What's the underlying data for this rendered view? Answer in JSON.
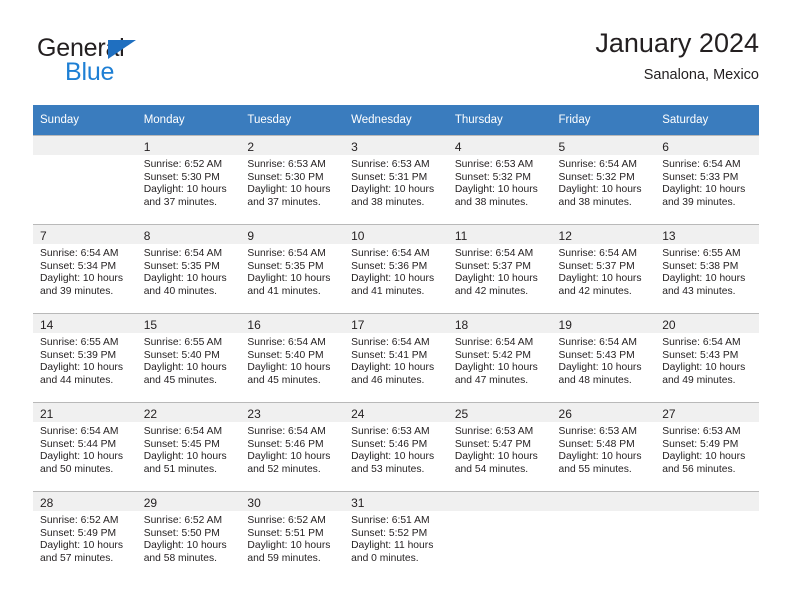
{
  "brand": {
    "name_dark": "General",
    "name_blue": "Blue",
    "triangle_color": "#1f6fc0",
    "blue_color": "#1e7fd4"
  },
  "header": {
    "title": "January 2024",
    "subtitle": "Sanalona, Mexico"
  },
  "theme": {
    "header_row_bg": "#3a7cbe",
    "daynum_band_bg": "#f0f0f0",
    "grid_line": "#b9b9b9",
    "text": "#231f20"
  },
  "weekday_headers": [
    "Sunday",
    "Monday",
    "Tuesday",
    "Wednesday",
    "Thursday",
    "Friday",
    "Saturday"
  ],
  "weeks": [
    [
      {
        "day": "",
        "lines": []
      },
      {
        "day": "1",
        "lines": [
          "Sunrise: 6:52 AM",
          "Sunset: 5:30 PM",
          "Daylight: 10 hours",
          "and 37 minutes."
        ]
      },
      {
        "day": "2",
        "lines": [
          "Sunrise: 6:53 AM",
          "Sunset: 5:30 PM",
          "Daylight: 10 hours",
          "and 37 minutes."
        ]
      },
      {
        "day": "3",
        "lines": [
          "Sunrise: 6:53 AM",
          "Sunset: 5:31 PM",
          "Daylight: 10 hours",
          "and 38 minutes."
        ]
      },
      {
        "day": "4",
        "lines": [
          "Sunrise: 6:53 AM",
          "Sunset: 5:32 PM",
          "Daylight: 10 hours",
          "and 38 minutes."
        ]
      },
      {
        "day": "5",
        "lines": [
          "Sunrise: 6:54 AM",
          "Sunset: 5:32 PM",
          "Daylight: 10 hours",
          "and 38 minutes."
        ]
      },
      {
        "day": "6",
        "lines": [
          "Sunrise: 6:54 AM",
          "Sunset: 5:33 PM",
          "Daylight: 10 hours",
          "and 39 minutes."
        ]
      }
    ],
    [
      {
        "day": "7",
        "lines": [
          "Sunrise: 6:54 AM",
          "Sunset: 5:34 PM",
          "Daylight: 10 hours",
          "and 39 minutes."
        ]
      },
      {
        "day": "8",
        "lines": [
          "Sunrise: 6:54 AM",
          "Sunset: 5:35 PM",
          "Daylight: 10 hours",
          "and 40 minutes."
        ]
      },
      {
        "day": "9",
        "lines": [
          "Sunrise: 6:54 AM",
          "Sunset: 5:35 PM",
          "Daylight: 10 hours",
          "and 41 minutes."
        ]
      },
      {
        "day": "10",
        "lines": [
          "Sunrise: 6:54 AM",
          "Sunset: 5:36 PM",
          "Daylight: 10 hours",
          "and 41 minutes."
        ]
      },
      {
        "day": "11",
        "lines": [
          "Sunrise: 6:54 AM",
          "Sunset: 5:37 PM",
          "Daylight: 10 hours",
          "and 42 minutes."
        ]
      },
      {
        "day": "12",
        "lines": [
          "Sunrise: 6:54 AM",
          "Sunset: 5:37 PM",
          "Daylight: 10 hours",
          "and 42 minutes."
        ]
      },
      {
        "day": "13",
        "lines": [
          "Sunrise: 6:55 AM",
          "Sunset: 5:38 PM",
          "Daylight: 10 hours",
          "and 43 minutes."
        ]
      }
    ],
    [
      {
        "day": "14",
        "lines": [
          "Sunrise: 6:55 AM",
          "Sunset: 5:39 PM",
          "Daylight: 10 hours",
          "and 44 minutes."
        ]
      },
      {
        "day": "15",
        "lines": [
          "Sunrise: 6:55 AM",
          "Sunset: 5:40 PM",
          "Daylight: 10 hours",
          "and 45 minutes."
        ]
      },
      {
        "day": "16",
        "lines": [
          "Sunrise: 6:54 AM",
          "Sunset: 5:40 PM",
          "Daylight: 10 hours",
          "and 45 minutes."
        ]
      },
      {
        "day": "17",
        "lines": [
          "Sunrise: 6:54 AM",
          "Sunset: 5:41 PM",
          "Daylight: 10 hours",
          "and 46 minutes."
        ]
      },
      {
        "day": "18",
        "lines": [
          "Sunrise: 6:54 AM",
          "Sunset: 5:42 PM",
          "Daylight: 10 hours",
          "and 47 minutes."
        ]
      },
      {
        "day": "19",
        "lines": [
          "Sunrise: 6:54 AM",
          "Sunset: 5:43 PM",
          "Daylight: 10 hours",
          "and 48 minutes."
        ]
      },
      {
        "day": "20",
        "lines": [
          "Sunrise: 6:54 AM",
          "Sunset: 5:43 PM",
          "Daylight: 10 hours",
          "and 49 minutes."
        ]
      }
    ],
    [
      {
        "day": "21",
        "lines": [
          "Sunrise: 6:54 AM",
          "Sunset: 5:44 PM",
          "Daylight: 10 hours",
          "and 50 minutes."
        ]
      },
      {
        "day": "22",
        "lines": [
          "Sunrise: 6:54 AM",
          "Sunset: 5:45 PM",
          "Daylight: 10 hours",
          "and 51 minutes."
        ]
      },
      {
        "day": "23",
        "lines": [
          "Sunrise: 6:54 AM",
          "Sunset: 5:46 PM",
          "Daylight: 10 hours",
          "and 52 minutes."
        ]
      },
      {
        "day": "24",
        "lines": [
          "Sunrise: 6:53 AM",
          "Sunset: 5:46 PM",
          "Daylight: 10 hours",
          "and 53 minutes."
        ]
      },
      {
        "day": "25",
        "lines": [
          "Sunrise: 6:53 AM",
          "Sunset: 5:47 PM",
          "Daylight: 10 hours",
          "and 54 minutes."
        ]
      },
      {
        "day": "26",
        "lines": [
          "Sunrise: 6:53 AM",
          "Sunset: 5:48 PM",
          "Daylight: 10 hours",
          "and 55 minutes."
        ]
      },
      {
        "day": "27",
        "lines": [
          "Sunrise: 6:53 AM",
          "Sunset: 5:49 PM",
          "Daylight: 10 hours",
          "and 56 minutes."
        ]
      }
    ],
    [
      {
        "day": "28",
        "lines": [
          "Sunrise: 6:52 AM",
          "Sunset: 5:49 PM",
          "Daylight: 10 hours",
          "and 57 minutes."
        ]
      },
      {
        "day": "29",
        "lines": [
          "Sunrise: 6:52 AM",
          "Sunset: 5:50 PM",
          "Daylight: 10 hours",
          "and 58 minutes."
        ]
      },
      {
        "day": "30",
        "lines": [
          "Sunrise: 6:52 AM",
          "Sunset: 5:51 PM",
          "Daylight: 10 hours",
          "and 59 minutes."
        ]
      },
      {
        "day": "31",
        "lines": [
          "Sunrise: 6:51 AM",
          "Sunset: 5:52 PM",
          "Daylight: 11 hours",
          "and 0 minutes."
        ]
      },
      {
        "day": "",
        "lines": []
      },
      {
        "day": "",
        "lines": []
      },
      {
        "day": "",
        "lines": []
      }
    ]
  ]
}
